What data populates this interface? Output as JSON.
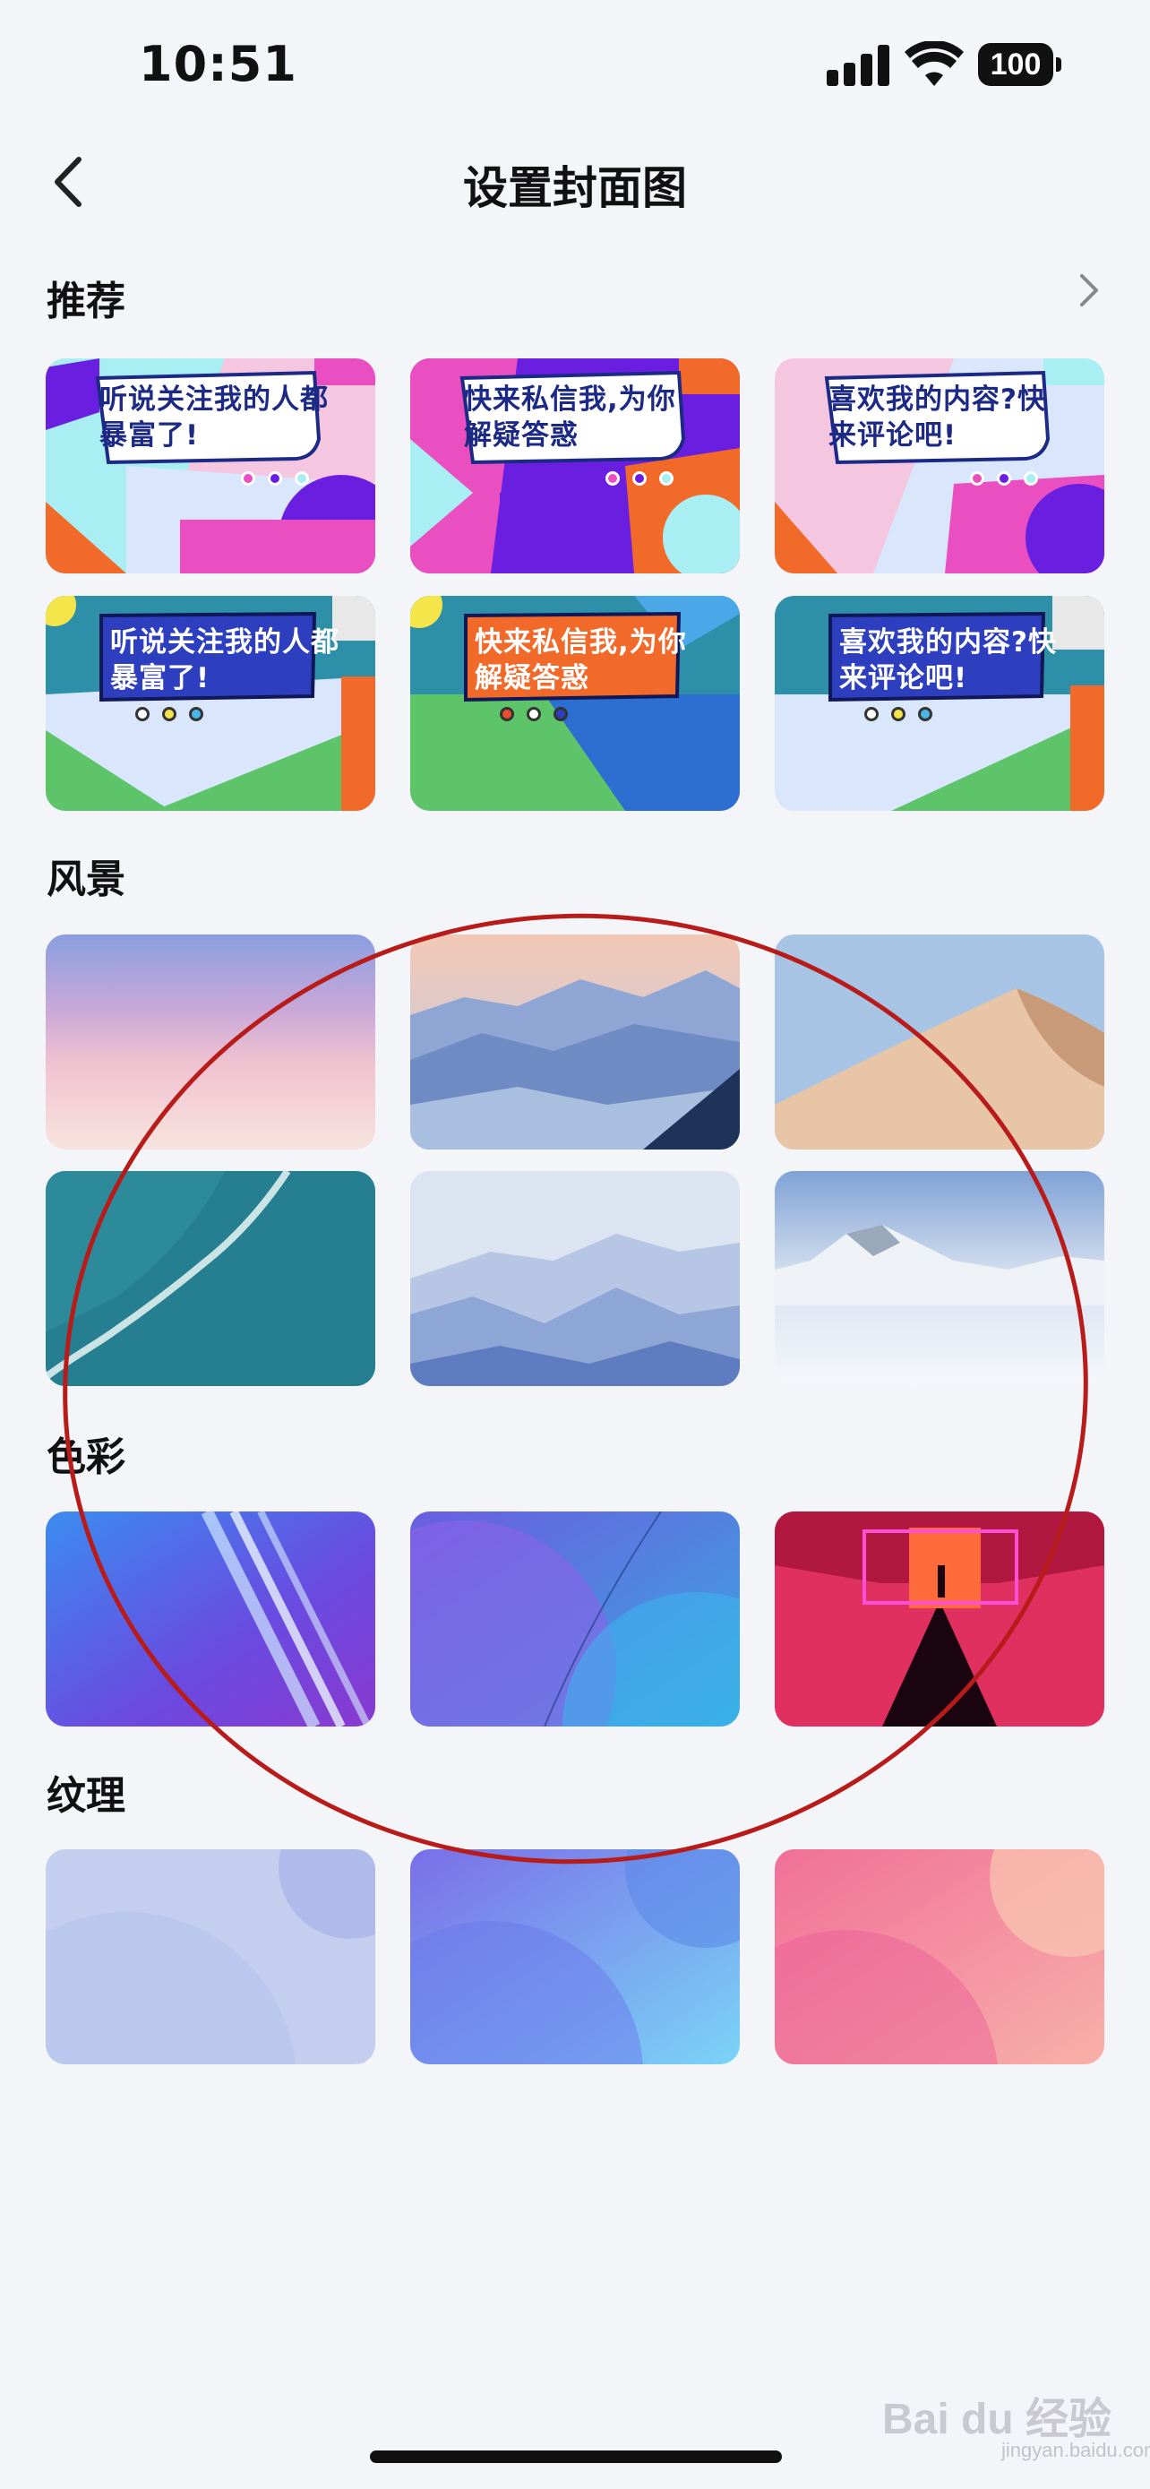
{
  "status": {
    "time": "10:51",
    "battery": "100"
  },
  "nav": {
    "title": "设置封面图",
    "back_icon": "chevron-left-icon"
  },
  "sections": {
    "recommend": {
      "title": "推荐",
      "more_icon": "chevron-right-icon",
      "covers": [
        {
          "text": "听说关注我的人都暴富了!"
        },
        {
          "text": "快来私信我,为你解疑答惑"
        },
        {
          "text": "喜欢我的内容?快来评论吧!"
        },
        {
          "text": "听说关注我的人都暴富了!"
        },
        {
          "text": "快来私信我,为你解疑答惑"
        },
        {
          "text": "喜欢我的内容?快来评论吧!"
        }
      ]
    },
    "scenery": {
      "title": "风景"
    },
    "color": {
      "title": "色彩"
    },
    "texture": {
      "title": "纹理"
    }
  },
  "watermark": {
    "brand": "Bai du 经验",
    "url": "jingyan.baidu.com"
  },
  "colors": {
    "background": "#f4f5f9",
    "annotation_circle": "#b81c1a"
  }
}
